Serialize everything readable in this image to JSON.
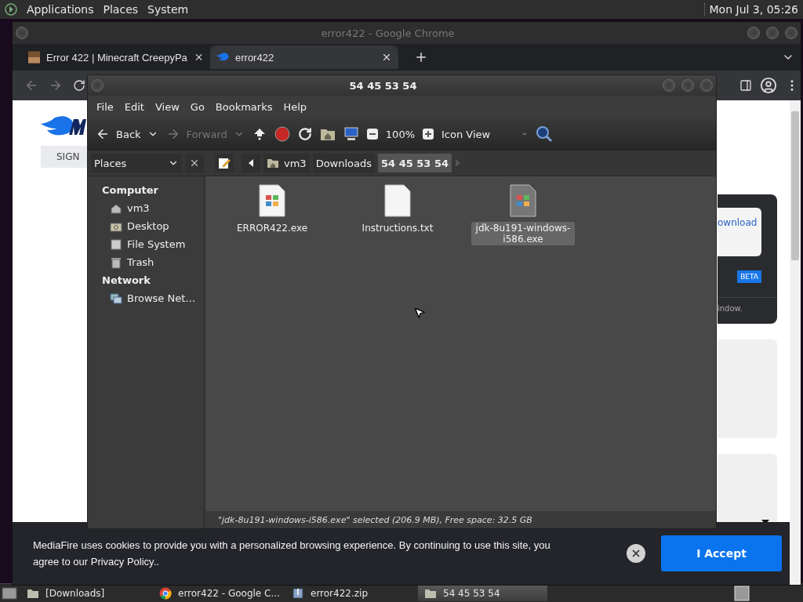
{
  "top_panel": {
    "menus": [
      "Applications",
      "Places",
      "System"
    ],
    "clock": "Mon Jul 3, 05:26"
  },
  "browser": {
    "title": "error422 - Google Chrome",
    "tabs": [
      {
        "label": "Error 422 | Minecraft CreepyPa",
        "kind": "minecraft",
        "selected": false
      },
      {
        "label": "error422",
        "kind": "mediafire",
        "selected": true
      }
    ],
    "page": {
      "sign_button": "SIGN",
      "download_text": "ownload",
      "beta_badge": "BETA",
      "window_text": "indow."
    },
    "cookie_banner": {
      "text": "MediaFire uses cookies to provide you with a personalized browsing experience. By continuing to use this site, you agree to our Privacy Policy..",
      "accept": "I Accept"
    }
  },
  "file_manager": {
    "title": "54 45 53 54",
    "menus": [
      "File",
      "Edit",
      "View",
      "Go",
      "Bookmarks",
      "Help"
    ],
    "toolbar": {
      "back": {
        "label": "Back",
        "disabled": false
      },
      "forward": {
        "label": "Forward",
        "disabled": true
      },
      "zoom": "100%",
      "view": "Icon View"
    },
    "places_label": "Places",
    "path": [
      {
        "label": "vm3",
        "kind": "home",
        "selected": false
      },
      {
        "label": "Downloads",
        "kind": "plain",
        "selected": false
      },
      {
        "label": "54 45 53 54",
        "kind": "plain",
        "selected": true
      }
    ],
    "sidebar": [
      {
        "heading": "Computer",
        "items": [
          {
            "label": "vm3",
            "kind": "home"
          },
          {
            "label": "Desktop",
            "kind": "desktop"
          },
          {
            "label": "File System",
            "kind": "drive"
          },
          {
            "label": "Trash",
            "kind": "trash"
          }
        ]
      },
      {
        "heading": "Network",
        "items": [
          {
            "label": "Browse Net…",
            "kind": "network"
          }
        ]
      }
    ],
    "files": [
      {
        "name": "ERROR422.exe",
        "kind": "exe",
        "selected": false
      },
      {
        "name": "Instructions.txt",
        "kind": "txt",
        "selected": false
      },
      {
        "name": "jdk-8u191-windows-i586.exe",
        "kind": "exe",
        "selected": true
      }
    ],
    "status": "\"jdk-8u191-windows-i586.exe\" selected (206.9 MB), Free space: 32.5 GB"
  },
  "taskbar": {
    "items": [
      {
        "label": "[Downloads]",
        "kind": "folder",
        "selected": false
      },
      {
        "label": "error422 - Google C...",
        "kind": "chrome",
        "selected": false
      },
      {
        "label": "error422.zip",
        "kind": "zip",
        "selected": false
      },
      {
        "label": "54 45 53 54",
        "kind": "folder",
        "selected": true
      }
    ]
  }
}
